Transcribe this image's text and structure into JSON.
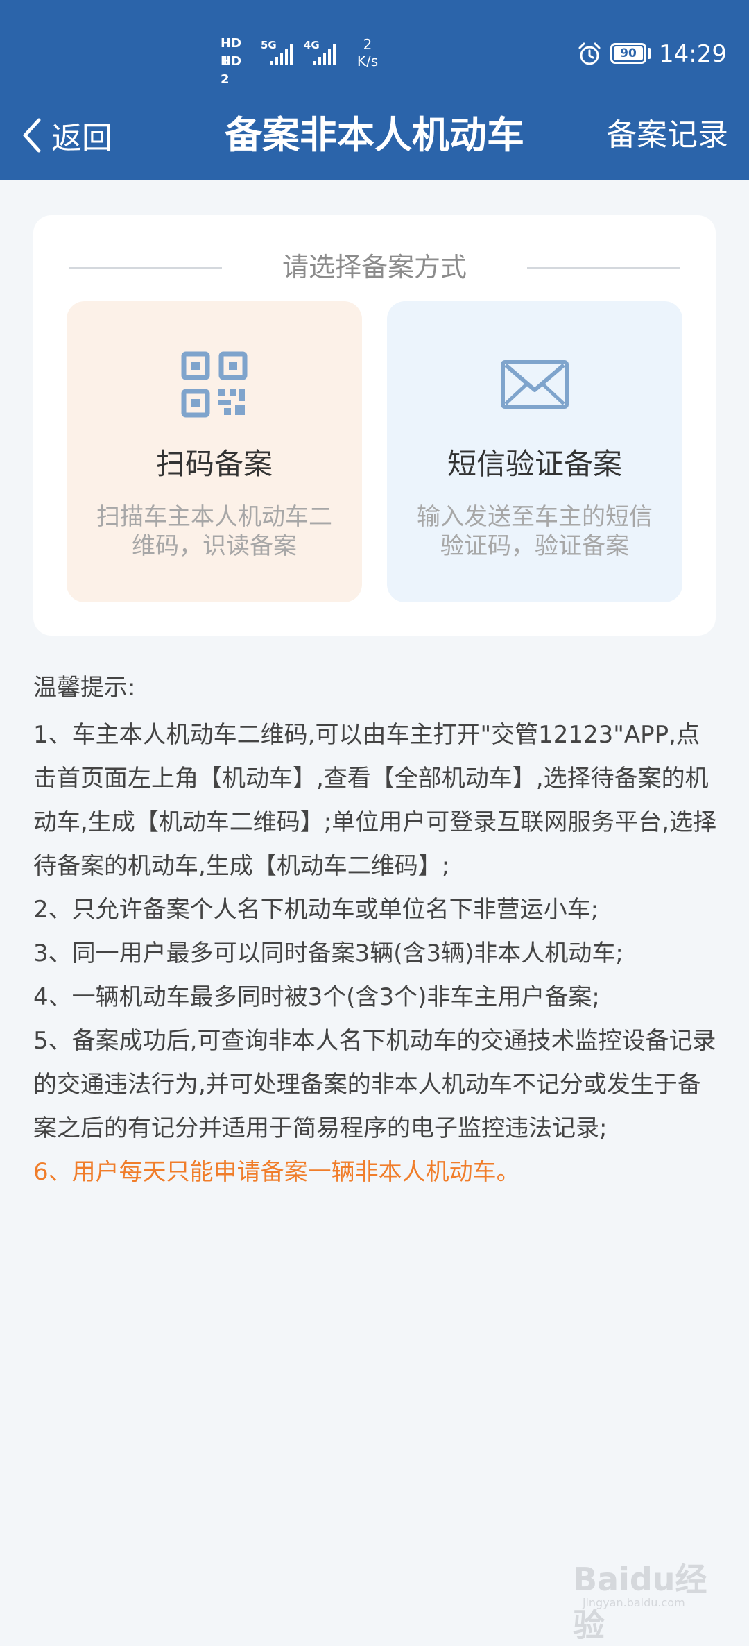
{
  "status_bar": {
    "sim1": "HD 1",
    "sim2": "HD 2",
    "signal1": "5G",
    "signal2": "4G",
    "speed_value": "2",
    "speed_unit": "K/s",
    "battery": "90",
    "time": "14:29"
  },
  "nav": {
    "back_label": "返回",
    "title": "备案非本人机动车",
    "records_label": "备案记录"
  },
  "card": {
    "heading": "请选择备案方式",
    "options": [
      {
        "title": "扫码备案",
        "desc": "扫描车主本人机动车二维码，识读备案",
        "icon": "qr-code-icon"
      },
      {
        "title": "短信验证备案",
        "desc": "输入发送至车主的短信验证码，验证备案",
        "icon": "envelope-icon"
      }
    ]
  },
  "tips": {
    "heading": "温馨提示:",
    "items": [
      "1、车主本人机动车二维码,可以由车主打开\"交管12123\"APP,点击首页面左上角【机动车】,查看【全部机动车】,选择待备案的机动车,生成【机动车二维码】;单位用户可登录互联网服务平台,选择待备案的机动车,生成【机动车二维码】;",
      "2、只允许备案个人名下机动车或单位名下非营运小车;",
      "3、同一用户最多可以同时备案3辆(含3辆)非本人机动车;",
      "4、一辆机动车最多同时被3个(含3个)非车主用户备案;",
      "5、备案成功后,可查询非本人名下机动车的交通技术监控设备记录的交通违法行为,并可处理备案的非本人机动车不记分或发生于备案之后的有记分并适用于简易程序的电子监控违法记录;",
      "6、用户每天只能申请备案一辆非本人机动车。"
    ]
  },
  "watermark": {
    "logo": "Baidu经验",
    "url": "jingyan.baidu.com"
  },
  "colors": {
    "header_bg": "#2b64aa",
    "page_bg": "#f3f6f9",
    "highlight": "#f07d2a",
    "icon_blue": "#7fa4cc",
    "qr_option_bg": "#fcf1e8",
    "sms_option_bg": "#ecf4fc"
  }
}
